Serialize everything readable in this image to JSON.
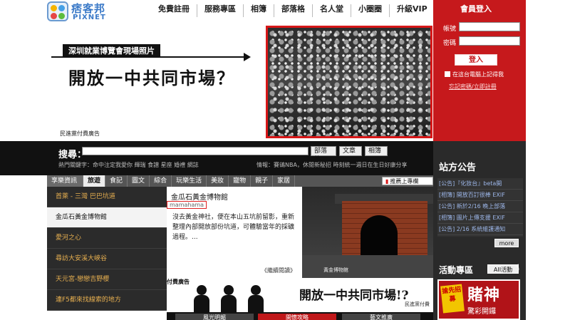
{
  "logo": {
    "cn": "痞客邦",
    "en": "PIXNET"
  },
  "topnav": [
    "免費註冊",
    "服務專區",
    "相簿",
    "部落格",
    "名人堂",
    "小圈圈",
    "升級VIP"
  ],
  "banner": {
    "subtitle": "深圳就業博覽會現場照片",
    "title": "開放一中共同市場？",
    "note": "民進黨付費廣告"
  },
  "search": {
    "label": "搜尋：",
    "buttons": [
      "部落格",
      "文章",
      "相簿"
    ],
    "hot_keywords": "熱門關鍵字：命中注定我愛你  輝瑞  食譜  星座  婚禮  網誌",
    "news": "情報：賽鴿NBA，休閒新秘招      時刻統一週日在生日好康分享"
  },
  "categories": {
    "items": [
      "享樂資訊",
      "旅遊",
      "食記",
      "圖文",
      "綜合",
      "玩樂生活",
      "美妝",
      "寵物",
      "親子",
      "家居"
    ],
    "active_index": 1,
    "upload": "推薦上專欄"
  },
  "left_list": [
    "首萊 - 三灣 巴巴坑道",
    "金瓜石黃金博物館",
    "愛河之心",
    "尋訪大安溪大峽谷",
    "天元宮-戀戀吉野櫻",
    "連F5都來找線索的地方"
  ],
  "left_active_index": 1,
  "article": {
    "title": "金瓜石黃金博物館",
    "author": "mamahama",
    "desc": "沒去黃金神社，便在本山五坑前留影，重新整理內部開放部份坑道，可體驗當年的採礦過程。...",
    "more": "《繼續閱讀》",
    "photo_caption": "黃金博物館"
  },
  "bottom_ad": {
    "label": "付費廣告",
    "title": "開放一中共同市場!?",
    "note": "民進黨付費"
  },
  "bottom_tabs": [
    "風光明媚",
    "開懷攻略",
    "藝文推廣"
  ],
  "login": {
    "title": "會員登入",
    "account_label": "帳號",
    "password_label": "密碼",
    "button": "登入",
    "remember": "在這台電腦上記得我",
    "forgot": "忘記密碼/立即註冊"
  },
  "announcements": {
    "title": "站方公告",
    "items": [
      "[公告]『化妝台』beta開",
      "[相簿] 開放百訂很棒 EXIF",
      "[公告] 新於2/16 晚上部落",
      "[相簿] 圖片上傳支援 EXIF",
      "[公告] 2/16 系統維護通知"
    ],
    "more": "more"
  },
  "events": {
    "title": "活動專區",
    "tag": "AII活動",
    "badge": "搶先招募",
    "banner_text": "賭神",
    "banner_sub": "驚彩開鑼"
  }
}
